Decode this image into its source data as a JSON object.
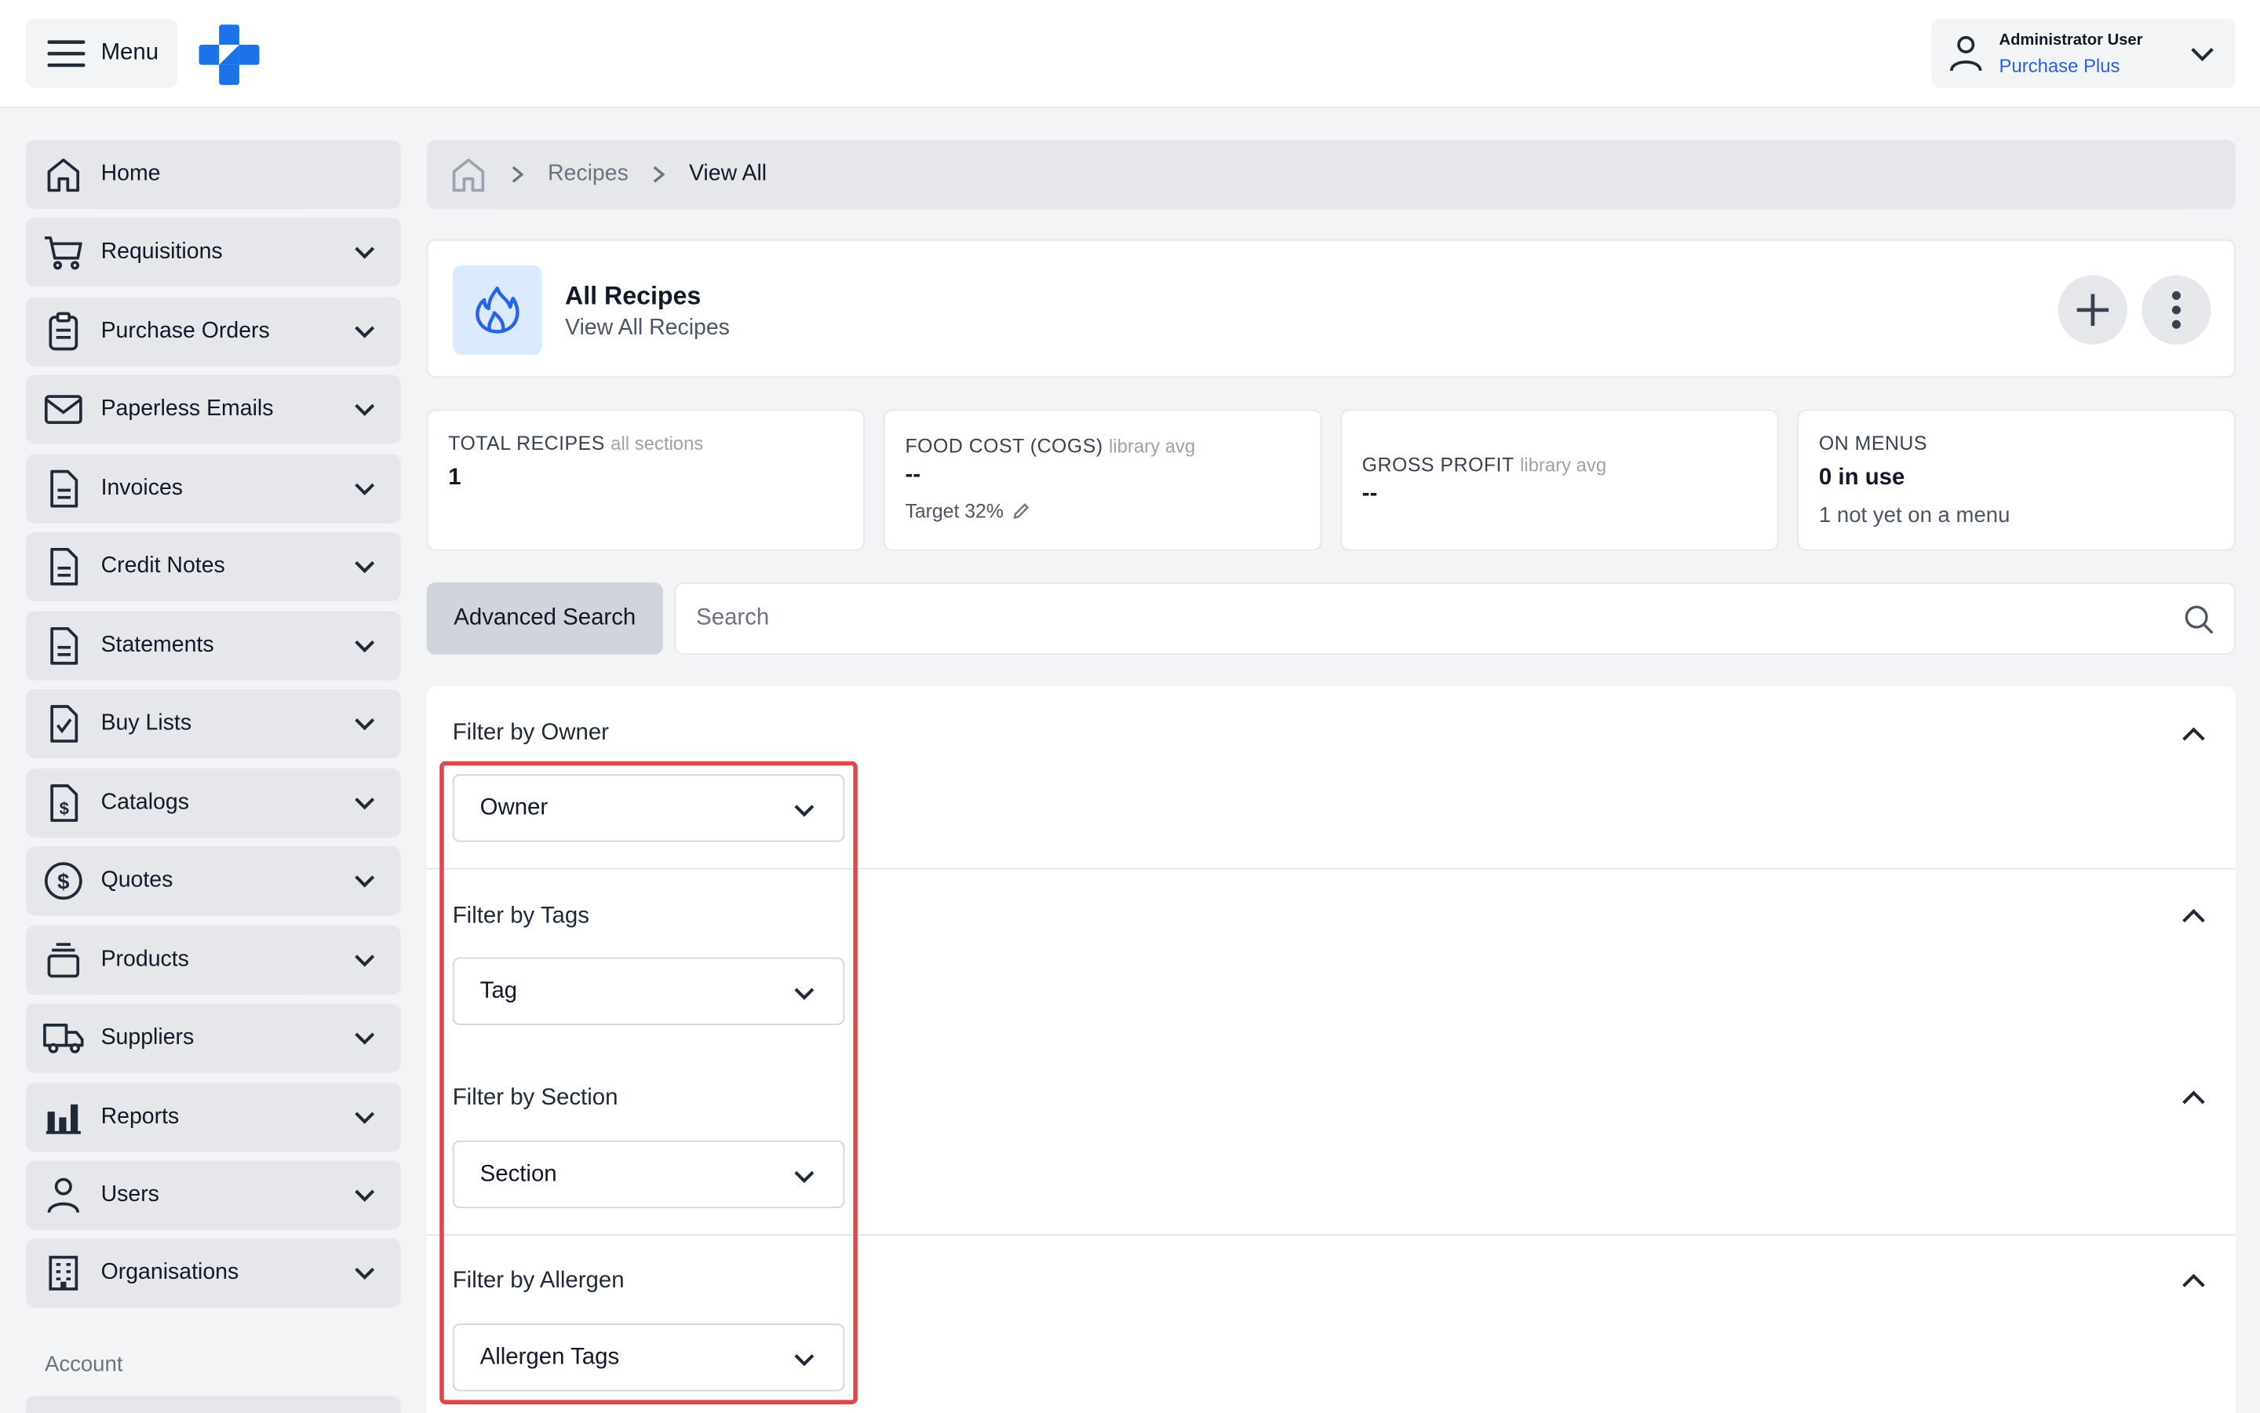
{
  "header": {
    "menu_label": "Menu",
    "user_name": "Administrator User",
    "user_org": "Purchase Plus",
    "brand_color": "#1a73e8"
  },
  "sidebar": {
    "items": [
      {
        "label": "Home",
        "icon": "home-icon"
      },
      {
        "label": "Requisitions",
        "icon": "cart-icon"
      },
      {
        "label": "Purchase Orders",
        "icon": "clipboard-icon"
      },
      {
        "label": "Paperless Emails",
        "icon": "envelope-icon"
      },
      {
        "label": "Invoices",
        "icon": "document-icon"
      },
      {
        "label": "Credit Notes",
        "icon": "document-icon"
      },
      {
        "label": "Statements",
        "icon": "document-icon"
      },
      {
        "label": "Buy Lists",
        "icon": "checklist-icon"
      },
      {
        "label": "Catalogs",
        "icon": "dollar-document-icon"
      },
      {
        "label": "Quotes",
        "icon": "dollar-circle-icon"
      },
      {
        "label": "Products",
        "icon": "stack-icon"
      },
      {
        "label": "Suppliers",
        "icon": "truck-icon"
      },
      {
        "label": "Reports",
        "icon": "bar-chart-icon"
      },
      {
        "label": "Users",
        "icon": "user-icon"
      },
      {
        "label": "Organisations",
        "icon": "building-icon"
      }
    ],
    "account_label": "Account"
  },
  "breadcrumb": {
    "items": [
      "Recipes",
      "View All"
    ]
  },
  "title_card": {
    "title": "All Recipes",
    "subtitle": "View All Recipes"
  },
  "stats": {
    "total": {
      "label": "TOTAL RECIPES",
      "note": "all sections",
      "value": "1"
    },
    "food_cost": {
      "label": "FOOD COST (COGS)",
      "note": "library avg",
      "value": "--",
      "target": "Target 32%"
    },
    "gross_profit": {
      "label": "GROSS PROFIT",
      "note": "library avg",
      "value": "--"
    },
    "on_menus": {
      "label": "ON MENUS",
      "value": "0 in use",
      "sub": "1 not yet on a menu"
    }
  },
  "search": {
    "advanced_label": "Advanced Search",
    "placeholder": "Search"
  },
  "filters": [
    {
      "title": "Filter by Owner",
      "select": "Owner"
    },
    {
      "title": "Filter by Tags",
      "select": "Tag"
    },
    {
      "title": "Filter by Section",
      "select": "Section"
    },
    {
      "title": "Filter by Allergen",
      "select": "Allergen Tags"
    }
  ],
  "highlight_color": "#e0464a"
}
